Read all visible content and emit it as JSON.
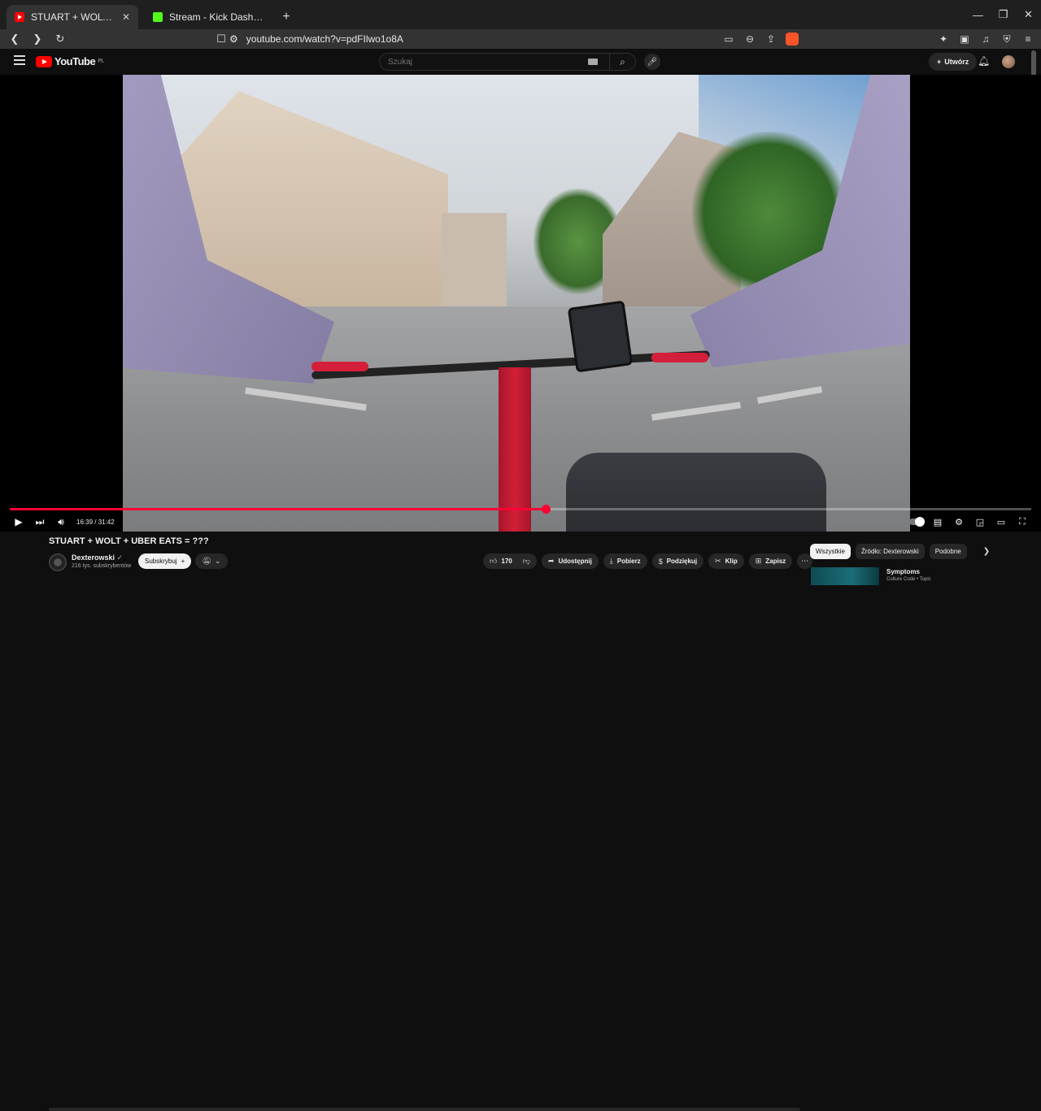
{
  "browser": {
    "tabs": [
      {
        "title": "STUART + WOLT + UBER EATS = ???",
        "active": true
      },
      {
        "title": "Stream - Kick Dashboard",
        "active": false
      }
    ],
    "url": "youtube.com/watch?v=pdFIlwo1o8A",
    "new_tab": "+",
    "close_tab": "✕"
  },
  "masthead": {
    "logo_text": "YouTube",
    "region": "PL",
    "search_placeholder": "Szukaj",
    "create_label": "Utwórz"
  },
  "player": {
    "time_current": "16:39",
    "time_total": "31:42",
    "time_display": "16:39 / 31:42",
    "progress": 0.525
  },
  "video": {
    "title": "STUART + WOLT + UBER EATS = ???",
    "channel": "Dexterowski",
    "subscribers": "216 tys. subskrybentów",
    "subscribe_label": "Subskrybuj",
    "likes": "170",
    "actions": [
      "Udostępnij",
      "Pobierz",
      "Podziękuj",
      "Klip",
      "Zapisz"
    ]
  },
  "sidebar": {
    "chips": [
      {
        "label": "Wszystkie",
        "active": true
      },
      {
        "label": "Źródło: Dexterowski",
        "active": false
      },
      {
        "label": "Podobne",
        "active": false
      }
    ],
    "recommendation": {
      "title": "Symptoms",
      "subtitle": "Culture Code • Topic"
    }
  },
  "colors": {
    "accent": "#ff0033",
    "background": "#0f0f0f",
    "chrome": "#333333"
  }
}
